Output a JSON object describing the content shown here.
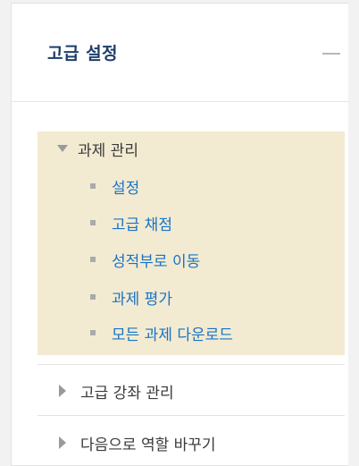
{
  "block": {
    "title": "고급 설정",
    "collapse_icon": "minus-icon"
  },
  "assignment_admin": {
    "label": "과제 관리",
    "expanded": true,
    "toggle_icon": "triangle-down-icon",
    "items": [
      {
        "label": "설정",
        "icon": "square-bullet-icon"
      },
      {
        "label": "고급 채점",
        "icon": "square-bullet-icon"
      },
      {
        "label": "성적부로 이동",
        "icon": "square-bullet-icon"
      },
      {
        "label": "과제 평가",
        "icon": "square-bullet-icon"
      },
      {
        "label": "모든 과제 다운로드",
        "icon": "square-bullet-icon"
      }
    ]
  },
  "collapsed_nodes": [
    {
      "label": "고급 강좌 관리",
      "icon": "triangle-right-icon"
    },
    {
      "label": "다음으로 역할 바꾸기",
      "icon": "triangle-right-icon"
    }
  ],
  "colors": {
    "title": "#1f3d6b",
    "link": "#1a73c5",
    "section_background": "#f2ebd2"
  }
}
